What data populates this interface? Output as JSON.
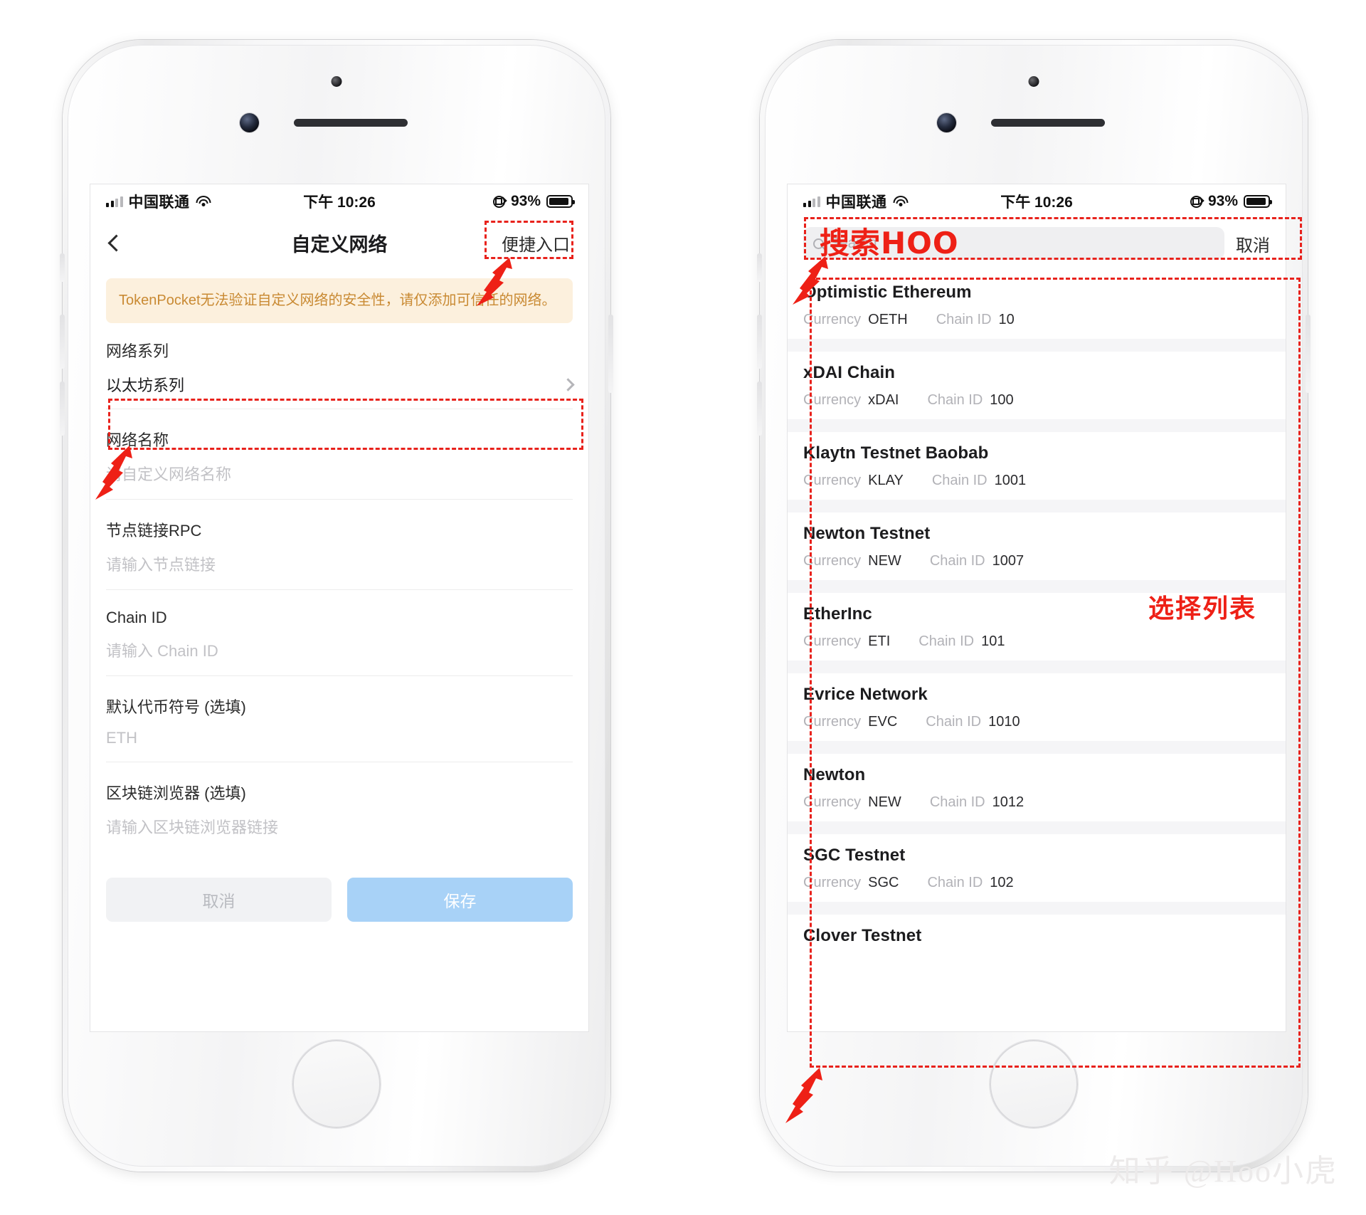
{
  "status_bar": {
    "carrier": "中国联通",
    "time": "下午 10:26",
    "battery_pct": "93%",
    "signal_icon": "cellular-bars-icon",
    "wifi_icon": "wifi-icon",
    "lock_icon": "rotation-lock-icon",
    "battery_icon": "battery-icon"
  },
  "left_phone": {
    "nav": {
      "back_icon": "back-chevron-icon",
      "title": "自定义网络",
      "action_label": "便捷入口"
    },
    "warning": "TokenPocket无法验证自定义网络的安全性，请仅添加可信任的网络。",
    "form": {
      "network_series_label": "网络系列",
      "network_series_value": "以太坊系列",
      "chevron_icon": "chevron-right-icon",
      "network_name_label": "网络名称",
      "network_name_placeholder": "请自定义网络名称",
      "rpc_label": "节点链接RPC",
      "rpc_placeholder": "请输入节点链接",
      "chain_id_label": "Chain ID",
      "chain_id_placeholder": "请输入 Chain ID",
      "symbol_label": "默认代币符号 (选填)",
      "symbol_placeholder": "ETH",
      "explorer_label": "区块链浏览器 (选填)",
      "explorer_placeholder": "请输入区块链浏览器链接"
    },
    "buttons": {
      "cancel": "取消",
      "save": "保存"
    }
  },
  "right_phone": {
    "search": {
      "icon": "search-icon",
      "placeholder": "Search",
      "cancel_label": "取消"
    },
    "list_meta": {
      "currency_key": "Currency",
      "chain_id_key": "Chain ID"
    },
    "chains": [
      {
        "name": "Optimistic Ethereum",
        "currency": "OETH",
        "chain_id": "10"
      },
      {
        "name": "xDAI Chain",
        "currency": "xDAI",
        "chain_id": "100"
      },
      {
        "name": "Klaytn Testnet Baobab",
        "currency": "KLAY",
        "chain_id": "1001"
      },
      {
        "name": "Newton Testnet",
        "currency": "NEW",
        "chain_id": "1007"
      },
      {
        "name": "EtherInc",
        "currency": "ETI",
        "chain_id": "101"
      },
      {
        "name": "Evrice Network",
        "currency": "EVC",
        "chain_id": "1010"
      },
      {
        "name": "Newton",
        "currency": "NEW",
        "chain_id": "1012"
      },
      {
        "name": "SGC Testnet",
        "currency": "SGC",
        "chain_id": "102"
      },
      {
        "name": "Clover Testnet",
        "currency": "",
        "chain_id": ""
      }
    ]
  },
  "annotations": {
    "search_hoo": "搜索HOO",
    "select_list": "选择列表",
    "accent_color": "#ee2016"
  },
  "watermark": "知乎 @Hoo小虎"
}
